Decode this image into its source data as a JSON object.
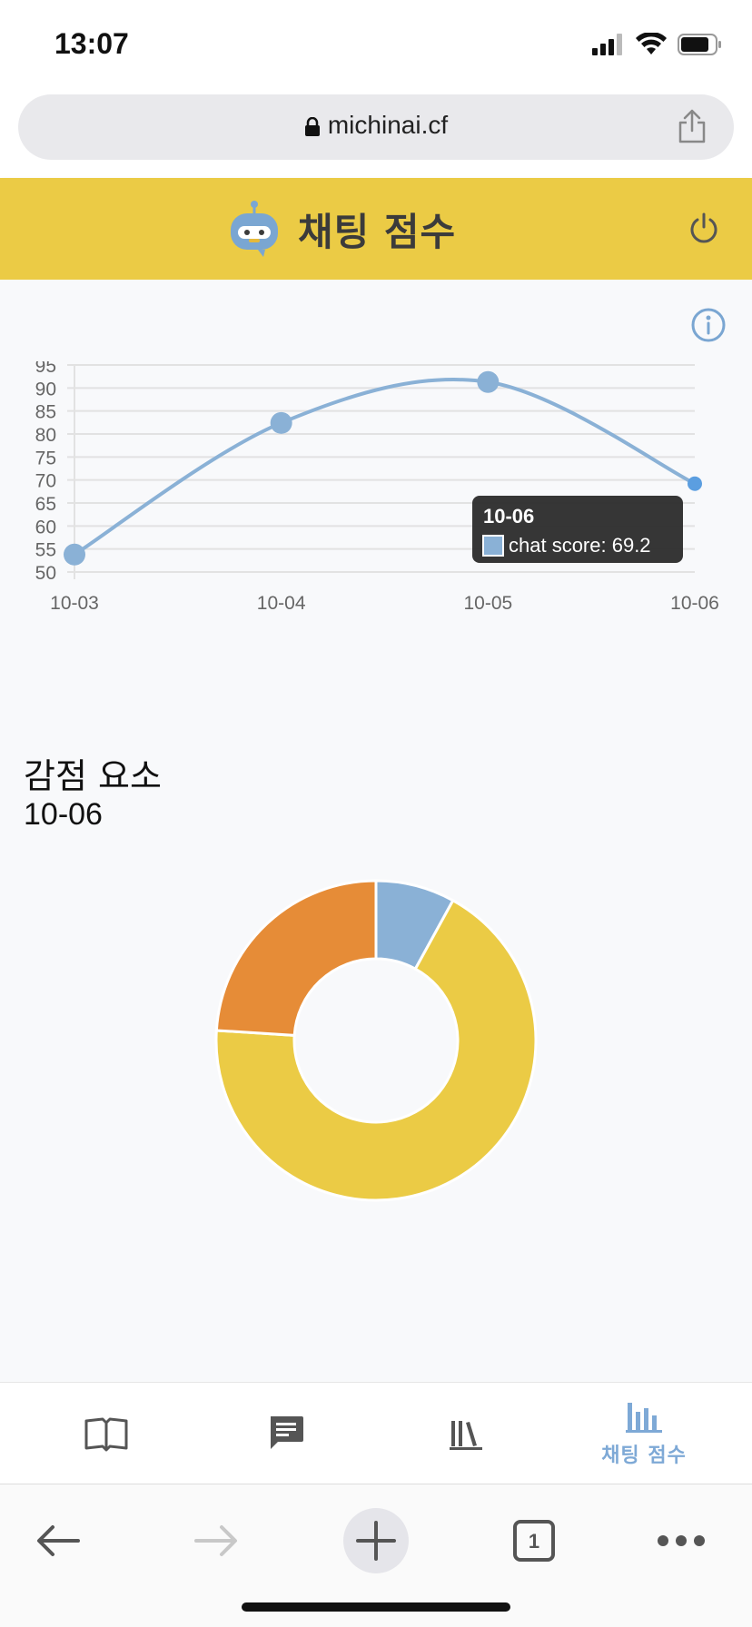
{
  "status_bar": {
    "time": "13:07"
  },
  "browser": {
    "url": "michinai.cf",
    "tab_count": "1"
  },
  "app": {
    "title": "채팅 점수",
    "colors": {
      "brand_yellow": "#ebcb45",
      "accent_blue": "#7ea9d6"
    }
  },
  "chart_data": [
    {
      "type": "line",
      "categories": [
        "10-03",
        "10-04",
        "10-05",
        "10-06"
      ],
      "series": [
        {
          "name": "chat score",
          "values": [
            53.8,
            82.4,
            91.3,
            69.2
          ],
          "color": "#8ab1d6"
        }
      ],
      "ylim": [
        50,
        95
      ],
      "yticks": [
        50,
        55,
        60,
        65,
        70,
        75,
        80,
        85,
        90,
        95
      ],
      "grid": true,
      "tooltip": {
        "title": "10-06",
        "label": "chat score: 69.2"
      }
    },
    {
      "type": "pie",
      "variant": "doughnut",
      "values": [
        8,
        68,
        24
      ],
      "colors": [
        "#8ab1d6",
        "#ebcb45",
        "#e68c37"
      ]
    }
  ],
  "section": {
    "title": "감점 요소",
    "date": "10-06"
  },
  "nav": {
    "items": [
      {
        "icon": "book-icon"
      },
      {
        "icon": "chat-icon"
      },
      {
        "icon": "library-icon"
      },
      {
        "icon": "bar-chart-icon",
        "label": "채팅 점수",
        "active": true
      }
    ]
  }
}
